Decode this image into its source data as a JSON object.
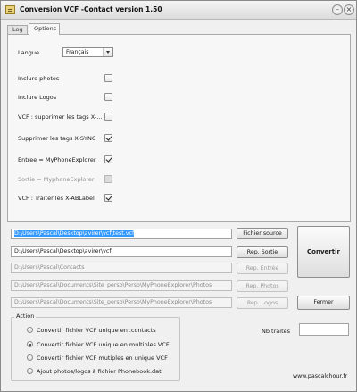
{
  "window": {
    "title": "Conversion VCF -Contact version 1.50",
    "minimize_glyph": "–",
    "close_glyph": "×"
  },
  "tabs": [
    {
      "label": "Log",
      "active": false
    },
    {
      "label": "Options",
      "active": true
    }
  ],
  "options": {
    "language_label": "Langue",
    "language_value": "Français",
    "checkboxes": [
      {
        "label": "Inclure photos",
        "checked": false,
        "enabled": true
      },
      {
        "label": "Inclure Logos",
        "checked": false,
        "enabled": true
      },
      {
        "label": "VCF : supprimer les tags X-...",
        "checked": false,
        "enabled": true
      },
      {
        "label": "Supprimer les tags X-SYNC",
        "checked": true,
        "enabled": true
      },
      {
        "label": "Entree = MyPhoneExplorer",
        "checked": true,
        "enabled": true
      },
      {
        "label": "Sortie = MyphoneExplorer",
        "checked": false,
        "enabled": false
      },
      {
        "label": "VCF : Traiter les X-ABLabel",
        "checked": true,
        "enabled": true
      }
    ]
  },
  "paths": {
    "source_file": "D:\\Users\\Pascal\\Desktop\\avirer\\vcf\\test.vcf",
    "output_dir": "D:\\Users\\Pascal\\Desktop\\avirer\\vcf",
    "entries_dir": "D:\\Users\\Pascal\\Contacts",
    "photos_dir": "D:\\Users\\Pascal\\Documents\\Site_perso\\Perso\\MyPhoneExplorer\\Photos",
    "logos_dir": "D:\\Users\\Pascal\\Documents\\Site_perso\\Perso\\MyPhoneExplorer\\Photos"
  },
  "buttons": {
    "source_file": "Fichier source",
    "output_dir": "Rep. Sortie",
    "entries_dir": "Rep. Entrée",
    "photos_dir": "Rep. Photos",
    "logos_dir": "Rep. Logos",
    "convert": "Convertir",
    "close": "Fermer"
  },
  "action": {
    "title": "Action",
    "selected_index": 1,
    "options": [
      "Convertir fichier VCF unique en .contacts",
      "Convertir fichier VCF unique en multiples VCF",
      "Convertir fichier VCF mutiples en unique VCF",
      "Ajout photos/logos à fichier Phonebook.dat"
    ]
  },
  "status": {
    "processed_label": "Nb traités",
    "processed_value": ""
  },
  "footer": {
    "website": "www.pascalchour.fr"
  }
}
